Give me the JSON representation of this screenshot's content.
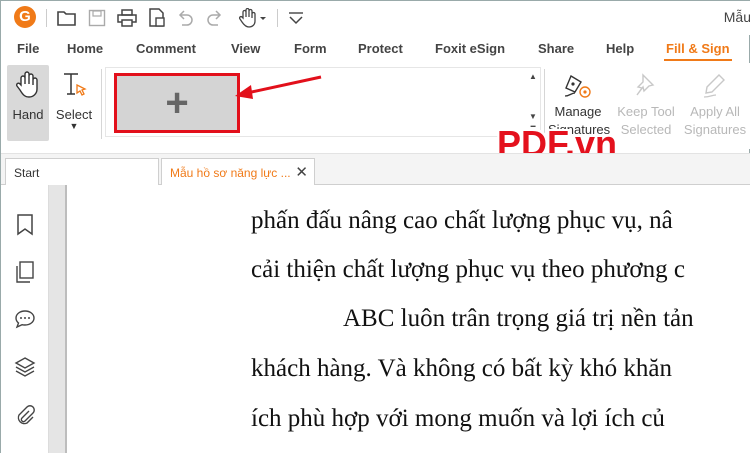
{
  "window_title": "Mẫu",
  "app_logo_letter": "G",
  "quick_access_icons": [
    "open-folder-icon",
    "save-icon",
    "print-icon",
    "create-pdf-icon",
    "undo-icon",
    "redo-icon",
    "hand-tool-icon",
    "customize-icon"
  ],
  "ribbon_tabs": [
    "File",
    "Home",
    "Comment",
    "View",
    "Form",
    "Protect",
    "Foxit eSign",
    "Share",
    "Help",
    "Fill & Sign"
  ],
  "active_tab": "Fill & Sign",
  "ribbon": {
    "hand_label": "Hand",
    "select_label": "Select",
    "add_signature_symbol": "+",
    "manage_label_1": "Manage",
    "manage_label_2": "Signatures",
    "keep_tool_label_1": "Keep Tool",
    "keep_tool_label_2": "Selected",
    "apply_all_label_1": "Apply All",
    "apply_all_label_2": "Signatures"
  },
  "watermark": "PDF.vn",
  "document_tabs": {
    "start": "Start",
    "file": "Mẫu hồ sơ năng lực ...",
    "close_symbol": "✕"
  },
  "left_nav_icons": [
    "bookmark-icon",
    "pages-icon",
    "comments-icon",
    "layers-icon",
    "attachments-icon"
  ],
  "document_lines": [
    "phấn đấu nâng cao chất lượng phục vụ, nâ",
    "cải thiện chất lượng phục vụ theo phương c",
    "ABC luôn trân trọng giá trị nền tản",
    "khách hàng. Và không có bất kỳ khó khăn",
    "ích phù hợp với mong muốn và lợi ích củ"
  ],
  "colors": {
    "accent": "#f07a18",
    "highlight_red": "#e2101b"
  }
}
